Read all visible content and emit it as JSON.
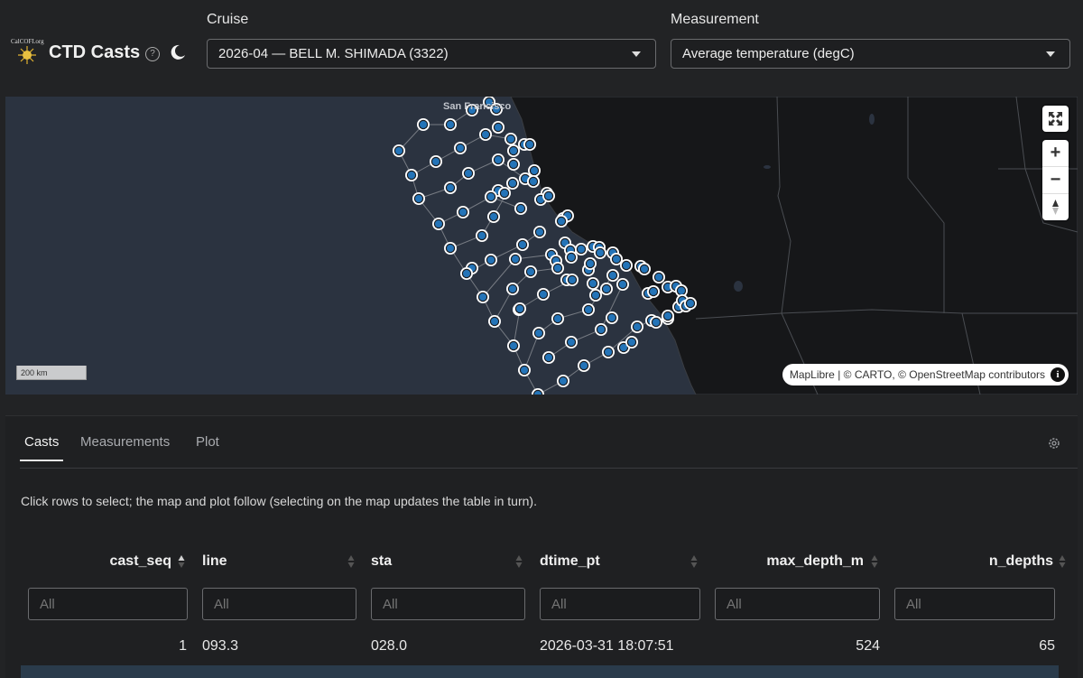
{
  "header": {
    "logo_text": "CalCOFI.org",
    "title": "CTD Casts",
    "cruise": {
      "label": "Cruise",
      "value": "2026-04 — BELL M. SHIMADA (3322)"
    },
    "measurement": {
      "label": "Measurement",
      "value": "Average temperature (degC)"
    }
  },
  "map": {
    "city_labels": [
      "San Francisco"
    ],
    "scale_label": "200 km",
    "controls": {
      "zoom_in": "+",
      "zoom_out": "−"
    },
    "attribution": {
      "maplibre": "MapLibre",
      "sep1": " | © ",
      "carto": "CARTO",
      "sep2": ", © ",
      "osm": "OpenStreetMap",
      "tail": " contributors",
      "info": "i"
    },
    "colors": {
      "land": "#161719",
      "ocean": "#2b3340",
      "station_fill": "#2474b8",
      "station_ring": "#ffffff"
    }
  },
  "tabs": [
    {
      "label": "Casts",
      "active": true
    },
    {
      "label": "Measurements",
      "active": false
    },
    {
      "label": "Plot",
      "active": false
    }
  ],
  "note": "Click rows to select; the map and plot follow (selecting on the map updates the table in turn).",
  "table": {
    "columns": [
      "cast_seq",
      "line",
      "sta",
      "dtime_pt",
      "max_depth_m",
      "n_depths"
    ],
    "filter_placeholder": "All",
    "rows": [
      [
        "1",
        "093.3",
        "028.0",
        "2026-03-31 18:07:51",
        "524",
        "65"
      ]
    ]
  }
}
